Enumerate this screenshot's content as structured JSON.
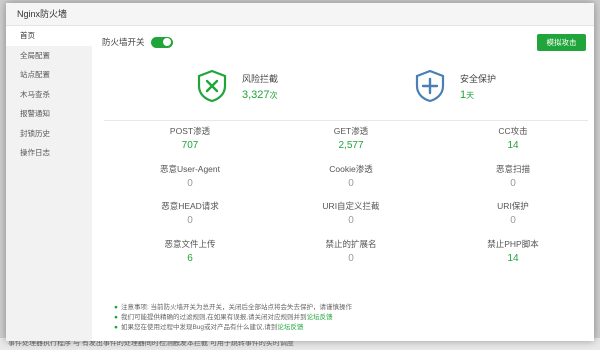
{
  "background": {
    "strip_text": "事件处理器执行程序  与 有发出事件的处理器同时检测触发本拦截  可用于跳转事件的实时调度"
  },
  "modal": {
    "title": "Nginx防火墙"
  },
  "sidebar": {
    "items": [
      {
        "label": "首页",
        "active": true
      },
      {
        "label": "全局配置"
      },
      {
        "label": "站点配置"
      },
      {
        "label": "木马查杀"
      },
      {
        "label": "报警通知"
      },
      {
        "label": "封锁历史"
      },
      {
        "label": "操作日志"
      }
    ]
  },
  "header": {
    "toggle_label": "防火墙开关",
    "toggle_on": true,
    "simulate_button": "模拟攻击"
  },
  "summary": {
    "intercept": {
      "label": "风险拦截",
      "value": "3,327",
      "unit": "次"
    },
    "protect": {
      "label": "安全保护",
      "value": "1",
      "unit": "天"
    }
  },
  "stats": [
    {
      "label": "POST渗透",
      "value": "707"
    },
    {
      "label": "GET渗透",
      "value": "2,577"
    },
    {
      "label": "CC攻击",
      "value": "14"
    },
    {
      "label": "恶意User-Agent",
      "value": "0"
    },
    {
      "label": "Cookie渗透",
      "value": "0"
    },
    {
      "label": "恶意扫描",
      "value": "0"
    },
    {
      "label": "恶意HEAD请求",
      "value": "0"
    },
    {
      "label": "URI自定义拦截",
      "value": "0"
    },
    {
      "label": "URI保护",
      "value": "0"
    },
    {
      "label": "恶意文件上传",
      "value": "6"
    },
    {
      "label": "禁止的扩展名",
      "value": "0"
    },
    {
      "label": "禁止PHP脚本",
      "value": "14"
    }
  ],
  "notes": [
    {
      "text": "注意事项: 当前防火墙开关为总开关，关闭后全部站点将会失去保护，请谨慎操作",
      "link": ""
    },
    {
      "text": "我们可能提供精确的过滤规则,在如果有误报,请关闭对应规则并到",
      "link": "论坛反馈"
    },
    {
      "text": "如果您在使用过程中发现Bug或对产品有什么建议,请到",
      "link": "论坛反馈"
    }
  ],
  "colors": {
    "accent": "#20a53a",
    "shield_green": "#20a53a",
    "shield_blue": "#4a7fb5"
  }
}
